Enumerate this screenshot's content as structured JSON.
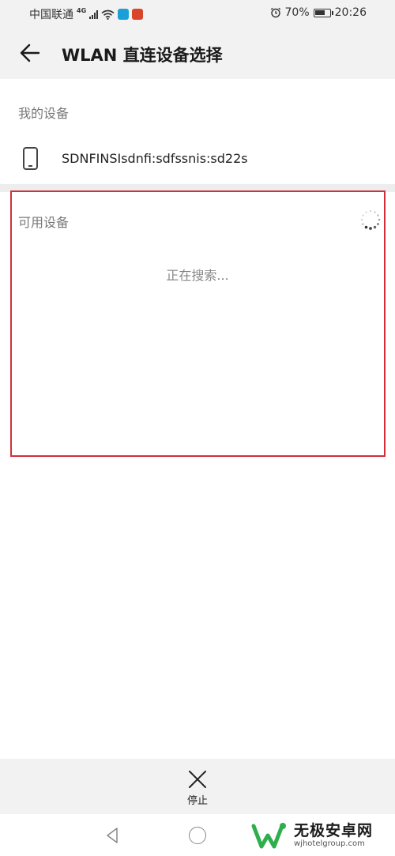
{
  "status_bar": {
    "carrier": "中国联通",
    "network": "4G",
    "battery": "70%",
    "battery_level": 0.7,
    "time": "20:26",
    "icons": [
      "signal-icon",
      "wifi-icon",
      "app-icon",
      "app-icon",
      "alarm-icon",
      "battery-icon"
    ]
  },
  "app_bar": {
    "title": "WLAN 直连设备选择",
    "back_icon": "arrow-left-icon"
  },
  "my_devices": {
    "label": "我的设备",
    "device_name": "SDNFINSIsdnfi:sdfssnis:sd22s",
    "device_icon": "phone-icon"
  },
  "available_devices": {
    "label": "可用设备",
    "status": "正在搜索...",
    "spinner_icon": "loading-spinner-icon"
  },
  "bottom_action": {
    "label": "停止",
    "icon": "close-icon"
  },
  "nav_bar": {
    "icons": [
      "nav-back-icon",
      "nav-home-icon"
    ]
  },
  "watermark": {
    "text": "无极安卓网",
    "sub": "wjhotelgroup.com"
  },
  "colors": {
    "highlight_border": "#d0303a",
    "bar_background": "#f2f2f2",
    "watermark_green": "#2fae4c"
  }
}
